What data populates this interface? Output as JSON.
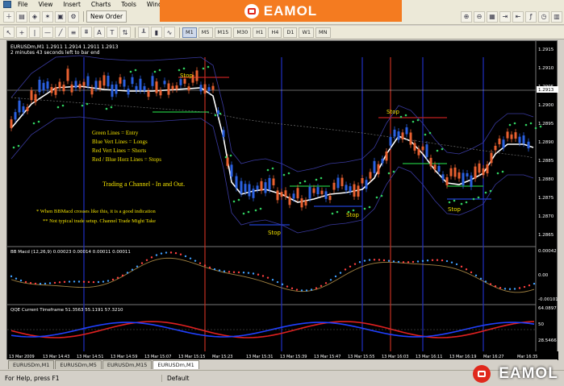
{
  "menu": [
    "File",
    "View",
    "Insert",
    "Charts",
    "Tools",
    "Window"
  ],
  "toolbar": {
    "new_order": "New Order",
    "timeframes": [
      "M1",
      "M5",
      "M15",
      "M30",
      "H1",
      "H4",
      "D1",
      "W1",
      "MN"
    ],
    "active_timeframe": "M1"
  },
  "watermark": {
    "brand": "EAMOL"
  },
  "chart": {
    "header_line1": "EURUSDm,M1  1.2911 1.2914 1.2911 1.2913",
    "header_line2": "2 minutes 43 seconds left to bar end",
    "price_labels": [
      "1.2915",
      "1.2910",
      "1.2905",
      "1.2900",
      "1.2895",
      "1.2890",
      "1.2885",
      "1.2880",
      "1.2875",
      "1.2870",
      "1.2865"
    ],
    "current_price": "1.2913",
    "legend": {
      "green": "Green Lines = Entry",
      "blue": "Blue Vert Lines = Longs",
      "red": "Red Vert Lines = Shorts",
      "horiz": "Red / Blue Horz Lines = Stops"
    },
    "trading_note": "Trading a Channel - In and Out.",
    "note1": "* When BBMacd crosses like this, it is a good indication",
    "note2": "** Not typical trade setup. Channel Trade Might Take",
    "stop_label": "Stop",
    "macd_header": "BB Macd (12,26,9) 0.00023 0.00014 0.00011 0.00011",
    "macd_labels": [
      "0.00042",
      "0.00",
      "-0.00101"
    ],
    "qqe_header": "QQE Current Timeframe 51.3563 55.1191 57.3210",
    "qqe_labels": [
      "64.0897",
      "50",
      "28.5466"
    ],
    "time_labels": [
      "13 Mar 2009",
      "13 Mar 14:43",
      "13 Mar 14:51",
      "13 Mar 14:59",
      "13 Mar 15:07",
      "13 Mar 15:15",
      "Mar 15:23",
      "13 Mar 15:31",
      "13 Mar 15:39",
      "13 Mar 15:47",
      "13 Mar 15:55",
      "13 Mar 16:03",
      "13 Mar 16:11",
      "13 Mar 16:19",
      "Mar 16:27",
      "Mar 16:35"
    ]
  },
  "tabs": [
    "EURUSDm,M1",
    "EURUSDm,M5",
    "EURUSDm,M15",
    "EURUSDm,M1"
  ],
  "active_tab": 3,
  "status": {
    "help": "For Help, press F1",
    "profile": "Default"
  }
}
